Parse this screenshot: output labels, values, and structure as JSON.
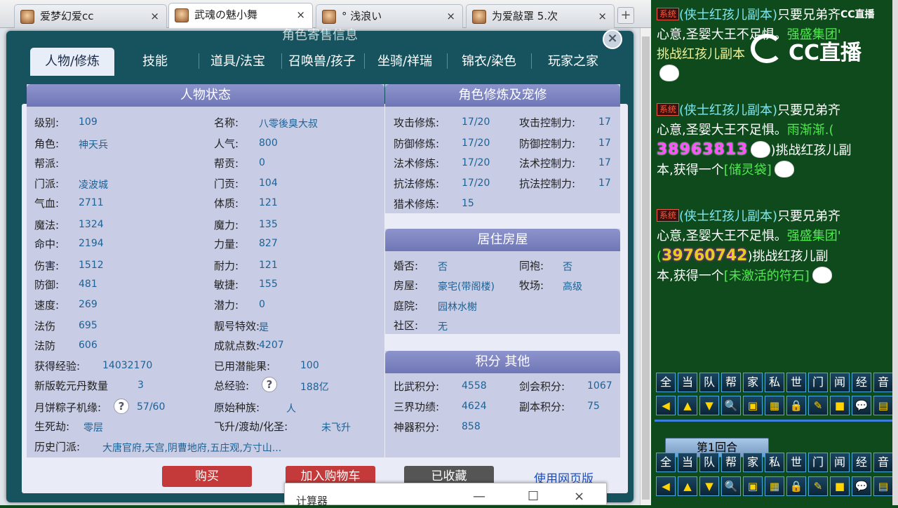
{
  "browser": {
    "tabs": [
      {
        "title": "爱梦幻爱",
        "badge": "cc",
        "active": false
      },
      {
        "title": "武魂の魅小舞",
        "active": true
      },
      {
        "title": "°  浅浪い",
        "active": false
      },
      {
        "title": "为爱敲罩 5.次",
        "active": false
      }
    ],
    "plus": "+",
    "close": "×"
  },
  "dialog": {
    "title": "角色寄售信息",
    "close": "×",
    "tabs": [
      "人物/修炼",
      "技能",
      "道具/法宝",
      "召唤兽/孩子",
      "坐骑/祥瑞",
      "锦衣/染色",
      "玩家之家"
    ]
  },
  "status": {
    "header": "人物状态",
    "left": [
      [
        "级别:",
        "109"
      ],
      [
        "角色:",
        "神天兵"
      ],
      [
        "帮派:",
        ""
      ],
      [
        "门派:",
        "凌波城"
      ],
      [
        "气血:",
        "2711"
      ],
      [
        "魔法:",
        "1324"
      ],
      [
        "命中:",
        "2194"
      ],
      [
        "伤害:",
        "1512"
      ],
      [
        "防御:",
        "481"
      ],
      [
        "速度:",
        "269"
      ],
      [
        "法伤",
        "695"
      ],
      [
        "法防",
        "606"
      ]
    ],
    "right": [
      [
        "名称:",
        "八零後臭大叔"
      ],
      [
        "人气:",
        "800"
      ],
      [
        "帮贡:",
        "0"
      ],
      [
        "门贡:",
        "104"
      ],
      [
        "体质:",
        "121"
      ],
      [
        "魔力:",
        "135"
      ],
      [
        "力量:",
        "827"
      ],
      [
        "耐力:",
        "121"
      ],
      [
        "敏捷:",
        "155"
      ],
      [
        "潜力:",
        "0"
      ],
      [
        "靓号特效:",
        "是"
      ],
      [
        "成就点数:",
        "4207"
      ]
    ],
    "exp_label": "获得经验:",
    "exp": "14032170",
    "potion_label": "已用潜能果:",
    "potion": "100",
    "qy_label": "新版乾元丹数量",
    "qy": "3",
    "total_exp_label": "总经验:",
    "total_exp": "188亿",
    "moon_label": "月饼粽子机缘:",
    "moon": "57/60",
    "race_label": "原始种族:",
    "race": "人",
    "life_label": "生死劫:",
    "life": "零层",
    "fly_label": "飞升/渡劫/化圣:",
    "fly": "未飞升",
    "hist_label": "历史门派:",
    "hist": "大唐官府,天宫,阴曹地府,五庄观,方寸山...",
    "q": "?"
  },
  "cultivation": {
    "header": "角色修炼及宠修",
    "rows": [
      [
        "攻击修炼:",
        "17/20",
        "攻击控制力:",
        "17"
      ],
      [
        "防御修炼:",
        "17/20",
        "防御控制力:",
        "17"
      ],
      [
        "法术修炼:",
        "17/20",
        "法术控制力:",
        "17"
      ],
      [
        "抗法修炼:",
        "17/20",
        "抗法控制力:",
        "17"
      ],
      [
        "猎术修炼:",
        "15",
        "",
        ""
      ]
    ]
  },
  "house": {
    "header": "居住房屋",
    "rows": [
      [
        "婚否:",
        "否",
        "同袍:",
        "否"
      ],
      [
        "房屋:",
        "豪宅(带阁楼)",
        "牧场:",
        "高级"
      ],
      [
        "庭院:",
        "园林水榭",
        "",
        ""
      ],
      [
        "社区:",
        "无",
        "",
        ""
      ]
    ]
  },
  "points": {
    "header": "积分 其他",
    "rows": [
      [
        "比武积分:",
        "4558",
        "剑会积分:",
        "1067"
      ],
      [
        "三界功绩:",
        "4624",
        "副本积分:",
        "75"
      ],
      [
        "神器积分:",
        "858",
        "",
        ""
      ]
    ]
  },
  "buttons": {
    "buy": "购买",
    "cart": "加入购物车",
    "fav": "已收藏",
    "web": "使用网页版"
  },
  "calc": {
    "title": "计算器",
    "min": "—",
    "max": "☐",
    "close": "×"
  },
  "chat": {
    "tag": "系统",
    "tag2": "系统",
    "tag3": "系统",
    "m1a": "(侠士红孩儿副本)",
    "m1b": "只要兄弟齐",
    "m1c": "心意,圣婴大王不足惧。",
    "m1d": "强盛集团'",
    "m1e": "挑战红孩儿副本",
    "m2a": "(侠士红孩儿副本)",
    "m2b": "只要兄弟齐",
    "m2c": "心意,圣婴大王不足惧。",
    "m2d": "雨渐渐.(",
    "m2e": "38963813",
    "m2f": ")挑战红孩儿副",
    "m2g": "本,获得一个",
    "m2h": "[储灵袋]",
    "m3a": "(侠士红孩儿副本)",
    "m3b": "只要兄弟齐",
    "m3c": "心意,圣婴大王不足惧。",
    "m3d": "强盛集团'",
    "m3e": "(",
    "m3f": "39760742",
    ")": ")",
    "m3g": ")挑战红孩儿副",
    "m3h": "本,获得一个",
    "m3i": "[未激活的符石]"
  },
  "logo": {
    "text": "CC直播",
    "watermark": "CC直播"
  },
  "toolbar": [
    "全",
    "当",
    "队",
    "帮",
    "家",
    "私",
    "世",
    "门",
    "闻",
    "经",
    "音"
  ],
  "toolbar_icons": [
    "◀",
    "▲",
    "▼",
    "🔍",
    "▣",
    "▦",
    "🔒",
    "✎",
    "■",
    "💬",
    "▤"
  ],
  "turn": "第1回合"
}
